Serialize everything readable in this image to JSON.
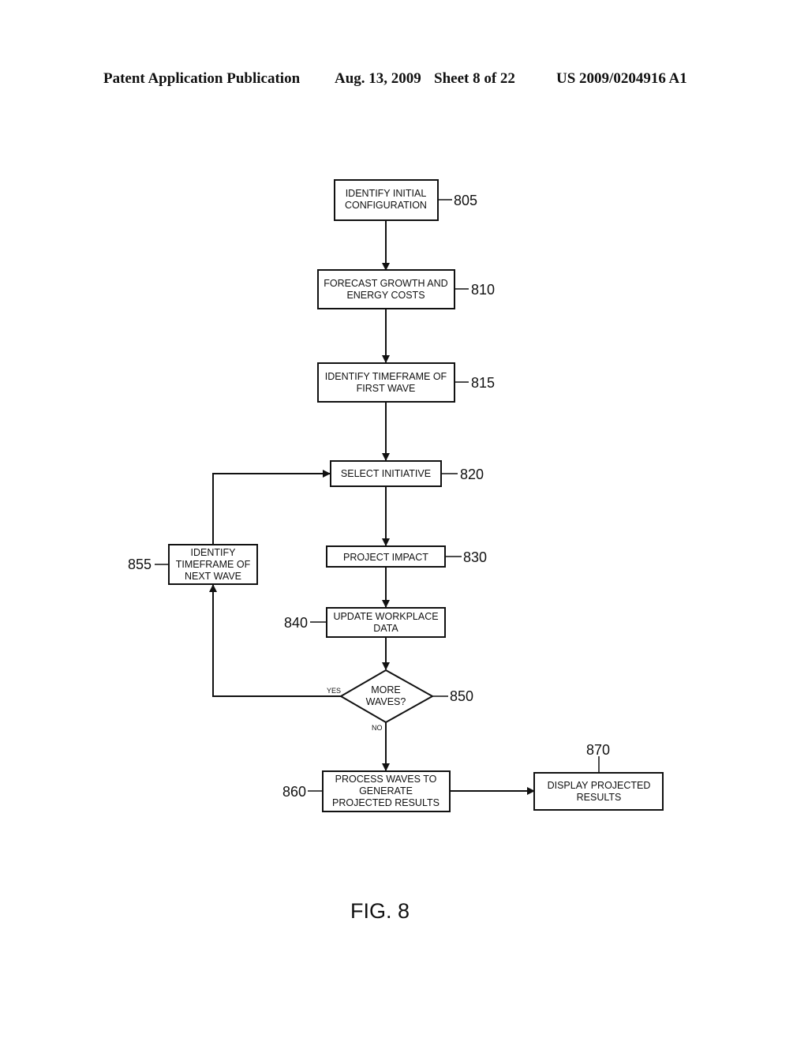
{
  "header": {
    "left": "Patent Application Publication",
    "date": "Aug. 13, 2009",
    "sheet": "Sheet 8 of 22",
    "pub_number": "US 2009/0204916 A1"
  },
  "figure_label": "FIG. 8",
  "nodes": {
    "n805": {
      "lines": [
        "IDENTIFY INITIAL",
        "CONFIGURATION"
      ],
      "ref": "805"
    },
    "n810": {
      "lines": [
        "FORECAST GROWTH AND",
        "ENERGY COSTS"
      ],
      "ref": "810"
    },
    "n815": {
      "lines": [
        "IDENTIFY TIMEFRAME OF",
        "FIRST WAVE"
      ],
      "ref": "815"
    },
    "n820": {
      "lines": [
        "SELECT INITIATIVE"
      ],
      "ref": "820"
    },
    "n830": {
      "lines": [
        "PROJECT IMPACT"
      ],
      "ref": "830"
    },
    "n840": {
      "lines": [
        "UPDATE WORKPLACE",
        "DATA"
      ],
      "ref": "840"
    },
    "n850": {
      "lines": [
        "MORE",
        "WAVES?"
      ],
      "ref": "850"
    },
    "n855": {
      "lines": [
        "IDENTIFY",
        "TIMEFRAME OF",
        "NEXT  WAVE"
      ],
      "ref": "855"
    },
    "n860": {
      "lines": [
        "PROCESS WAVES TO",
        "GENERATE",
        "PROJECTED RESULTS"
      ],
      "ref": "860"
    },
    "n870": {
      "lines": [
        "DISPLAY PROJECTED",
        "RESULTS"
      ],
      "ref": "870"
    }
  },
  "edge_labels": {
    "yes": "YES",
    "no": "NO"
  }
}
